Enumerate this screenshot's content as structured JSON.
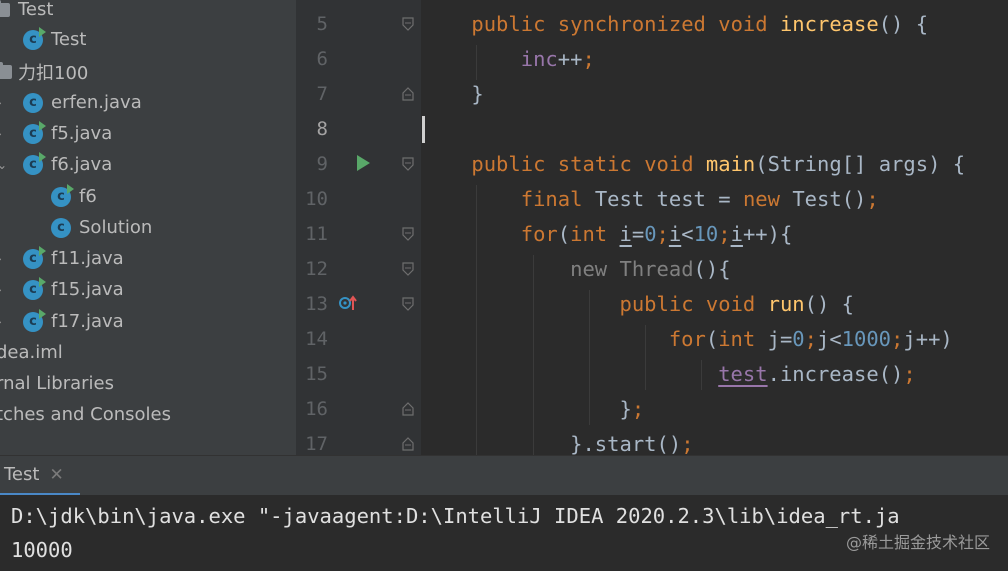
{
  "project_tree": {
    "items": [
      {
        "label": "Test",
        "kind": "folder",
        "arrow": ""
      },
      {
        "label": "Test",
        "kind": "class",
        "run": true
      },
      {
        "label": "力扣100",
        "kind": "folder",
        "arrow": ""
      },
      {
        "label": "erfen.java",
        "kind": "class",
        "arrow": "›"
      },
      {
        "label": "f5.java",
        "kind": "class",
        "run": true,
        "arrow": "›"
      },
      {
        "label": "f6.java",
        "kind": "class",
        "run": true,
        "arrow": "⌄"
      },
      {
        "label": "f6",
        "kind": "class",
        "run": true
      },
      {
        "label": "Solution",
        "kind": "class"
      },
      {
        "label": "f11.java",
        "kind": "class",
        "run": true,
        "arrow": "›"
      },
      {
        "label": "f15.java",
        "kind": "class",
        "run": true,
        "arrow": "›"
      },
      {
        "label": "f17.java",
        "kind": "class",
        "run": true,
        "arrow": "›"
      },
      {
        "label": "dea.iml",
        "kind": "file"
      },
      {
        "label": "rnal Libraries",
        "kind": "lib"
      },
      {
        "label": "tches and Consoles",
        "kind": "lib"
      }
    ],
    "class_icon_letter": "c"
  },
  "editor": {
    "line_numbers": [
      "5",
      "6",
      "7",
      "8",
      "9",
      "10",
      "11",
      "12",
      "13",
      "14",
      "15",
      "16",
      "17"
    ],
    "code_lines": [
      "    public synchronized void increase() {",
      "        inc++;",
      "    }",
      "",
      "    public static void main(String[] args) {",
      "        final Test test = new Test();",
      "        for(int i=0;i<10;i++){",
      "            new Thread(){",
      "                public void run() {",
      "                    for(int j=0;j<1000;j++)",
      "                        test.increase();",
      "                };",
      "            }.start();"
    ]
  },
  "run_panel": {
    "tab_label": "Test",
    "close_glyph": "✕",
    "console_lines": [
      "D:\\jdk\\bin\\java.exe \"-javaagent:D:\\IntelliJ IDEA 2020.2.3\\lib\\idea_rt.ja",
      "10000"
    ]
  },
  "watermark": "@稀土掘金技术社区",
  "colors": {
    "keyword": "#cc7832",
    "method": "#ffc66d",
    "field": "#9876aa",
    "number": "#6897bb",
    "run_green": "#59a869",
    "class_icon": "#3592c4"
  }
}
